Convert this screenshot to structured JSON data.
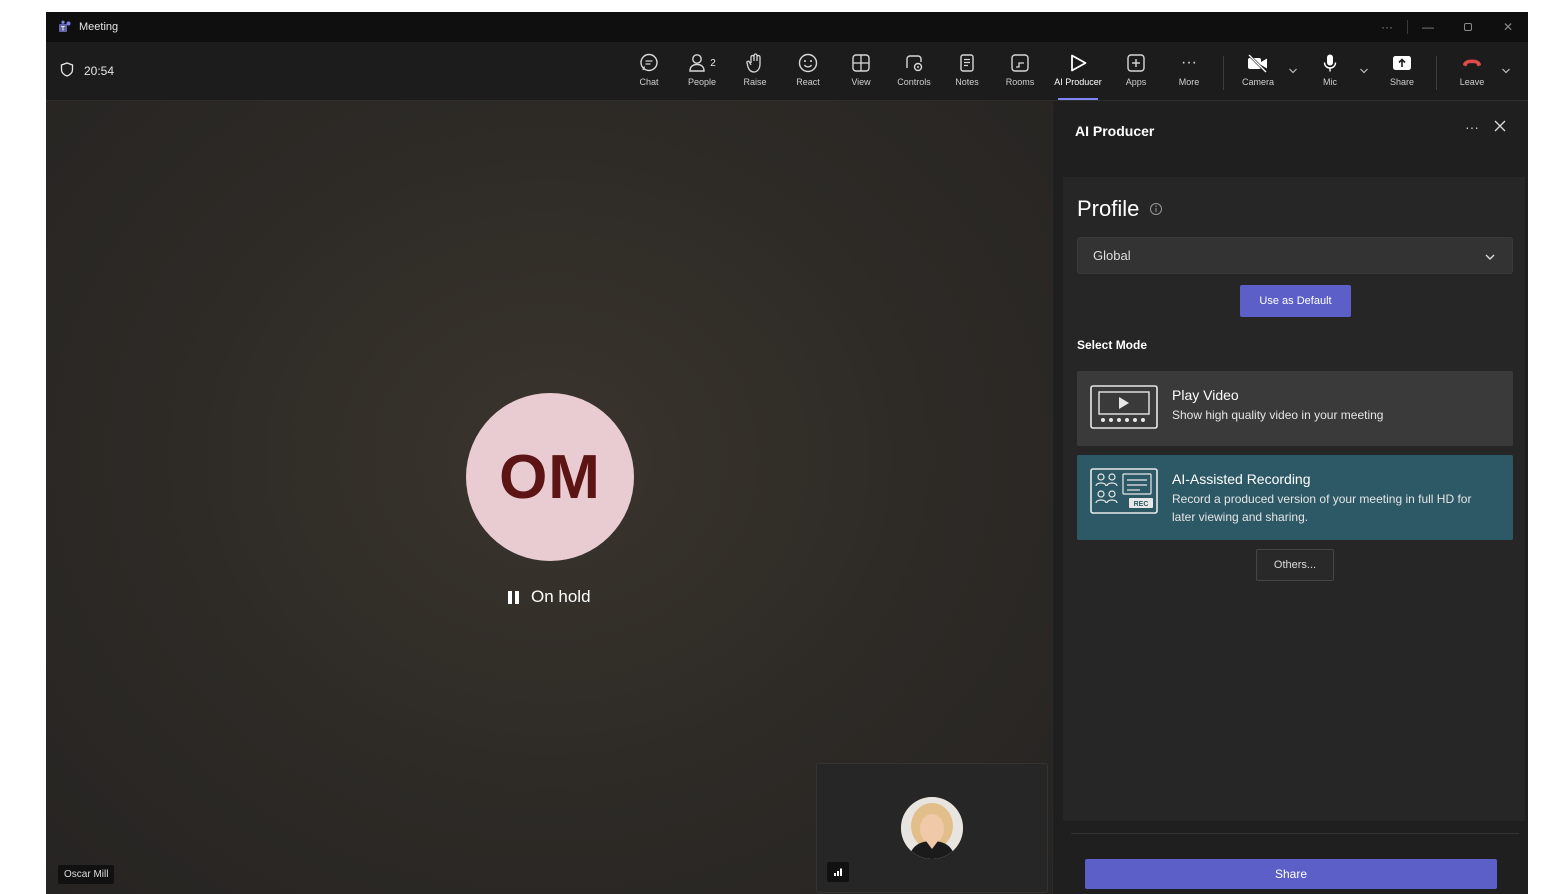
{
  "window": {
    "title": "Meeting",
    "controls": [
      "more",
      "minimize",
      "restore",
      "close"
    ]
  },
  "toolbar": {
    "timer": "20:54",
    "people_count": "2",
    "buttons": {
      "chat": "Chat",
      "people": "People",
      "raise": "Raise",
      "react": "React",
      "view": "View",
      "controls": "Controls",
      "notes": "Notes",
      "rooms": "Rooms",
      "ai_producer": "AI Producer",
      "apps": "Apps",
      "more": "More",
      "camera": "Camera",
      "mic": "Mic",
      "share": "Share",
      "leave": "Leave"
    },
    "active_button": "AI Producer"
  },
  "stage": {
    "participant_initials": "OM",
    "status": "On hold",
    "participant_name": "Oscar Mill"
  },
  "panel": {
    "title": "AI Producer",
    "profile_label": "Profile",
    "profile_value": "Global",
    "use_default_label": "Use as Default",
    "select_mode_label": "Select Mode",
    "modes": [
      {
        "title": "Play Video",
        "description": "Show high quality video in your meeting"
      },
      {
        "title": "AI-Assisted Recording",
        "description": "Record a produced version of your meeting in full HD for later viewing and sharing."
      }
    ],
    "selected_mode": "AI-Assisted Recording",
    "others_label": "Others...",
    "share_label": "Share"
  },
  "colors": {
    "accent": "#5b5fc7",
    "selected_mode_bg": "#2d5967",
    "avatar_bg": "#e9ccd1",
    "avatar_text": "#5c1414",
    "leave_red": "#e04a4a"
  }
}
